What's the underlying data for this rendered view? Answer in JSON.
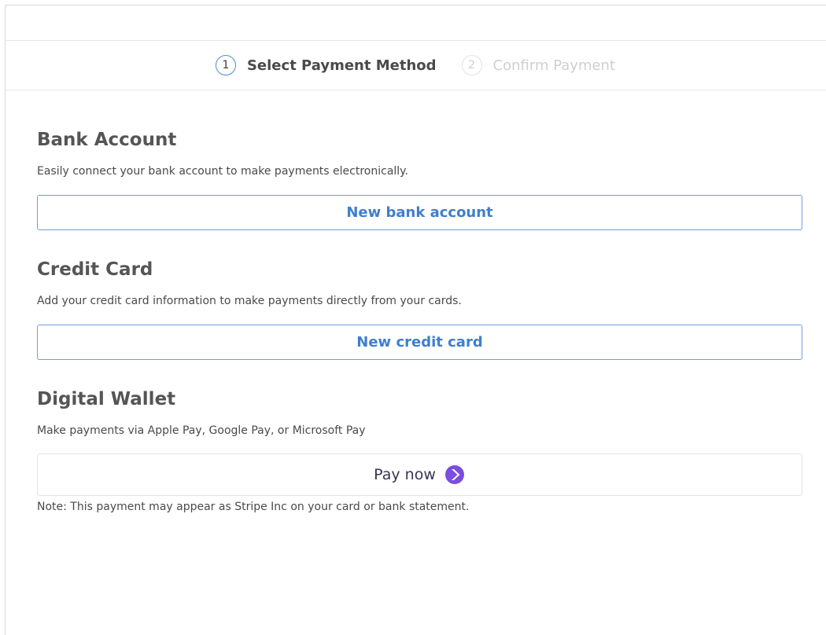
{
  "stepper": {
    "steps": [
      {
        "number": "1",
        "label": "Select Payment Method",
        "state": "active"
      },
      {
        "number": "2",
        "label": "Confirm Payment",
        "state": "inactive"
      }
    ]
  },
  "bank": {
    "title": "Bank Account",
    "description": "Easily connect your bank account to make payments electronically.",
    "button_label": "New bank account"
  },
  "credit": {
    "title": "Credit Card",
    "description": "Add your credit card information to make payments directly from your cards.",
    "button_label": "New credit card"
  },
  "wallet": {
    "title": "Digital Wallet",
    "description": "Make payments via Apple Pay, Google Pay, or Microsoft Pay",
    "button_label": "Pay now",
    "button_icon": "chevron-right-icon",
    "note": "Note: This payment may appear as Stripe Inc on your card or bank statement."
  },
  "colors": {
    "accent": "#4a8bd6",
    "button_text": "#3f7fcc",
    "pay_icon": "#7b4de0"
  }
}
